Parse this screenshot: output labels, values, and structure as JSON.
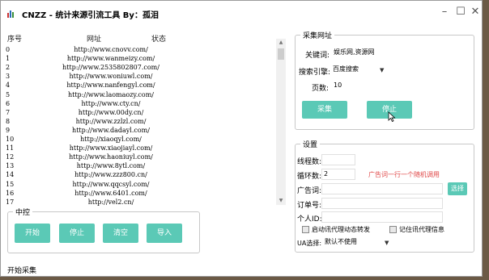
{
  "window": {
    "title": "CNZZ - 统计来源引流工具 By：孤泪"
  },
  "list": {
    "headers": {
      "index": "序号",
      "url": "网址",
      "status": "状态"
    },
    "rows": [
      {
        "index": "0",
        "url": "http://www.cnovv.com/"
      },
      {
        "index": "1",
        "url": "http://www.wanmeizy.com/"
      },
      {
        "index": "2",
        "url": "http://www.2535802807.com/"
      },
      {
        "index": "3",
        "url": "http://www.woniuwl.com/"
      },
      {
        "index": "4",
        "url": "http://www.nanfengyl.com/"
      },
      {
        "index": "5",
        "url": "http://www.laomaozy.com/"
      },
      {
        "index": "6",
        "url": "http://www.cty.cn/"
      },
      {
        "index": "7",
        "url": "http://www.00dy.cn/"
      },
      {
        "index": "8",
        "url": "http://www.zzlzl.com/"
      },
      {
        "index": "9",
        "url": "http://www.dadayl.com/"
      },
      {
        "index": "10",
        "url": "http://xiaoqyl.com/"
      },
      {
        "index": "11",
        "url": "http://www.xiaojiayl.com/"
      },
      {
        "index": "12",
        "url": "http://www.haoniuyl.com/"
      },
      {
        "index": "13",
        "url": "http://www.8ytl.com/"
      },
      {
        "index": "14",
        "url": "http://www.zzz800.cn/"
      },
      {
        "index": "15",
        "url": "http://www.qqcsyl.com/"
      },
      {
        "index": "16",
        "url": "http://www.6401.com/"
      },
      {
        "index": "17",
        "url": "http://vel2.cn/"
      }
    ]
  },
  "middle": {
    "legend": "中控",
    "start": "开始",
    "stop": "停止",
    "clear": "清空",
    "import": "导入"
  },
  "collect": {
    "legend": "采集网址",
    "keyword_label": "关键词:",
    "keyword_value": "娱乐网,资源网",
    "engine_label": "搜索引擎:",
    "engine_value": "百度搜索",
    "pages_label": "页数:",
    "pages_value": "10",
    "collect_btn": "采集",
    "stop_btn": "停止"
  },
  "settings": {
    "legend": "设置",
    "threads_label": "线程数:",
    "threads_value": "",
    "loops_label": "循环数:",
    "loops_value": "2",
    "loops_hint": "广告词一行一个随机调用",
    "ad_label": "广告词:",
    "select_btn": "选择",
    "order_label": "订单号:",
    "personal_label": "个人ID:",
    "opt_proxy": "启动讯代理动态转发",
    "opt_remember": "记住讯代理信息",
    "ua_label": "UA选择:",
    "ua_value": "默认不使用"
  },
  "status_text": "开始采集",
  "colors": {
    "accent": "#5bc9b6",
    "hint": "#e04848"
  }
}
